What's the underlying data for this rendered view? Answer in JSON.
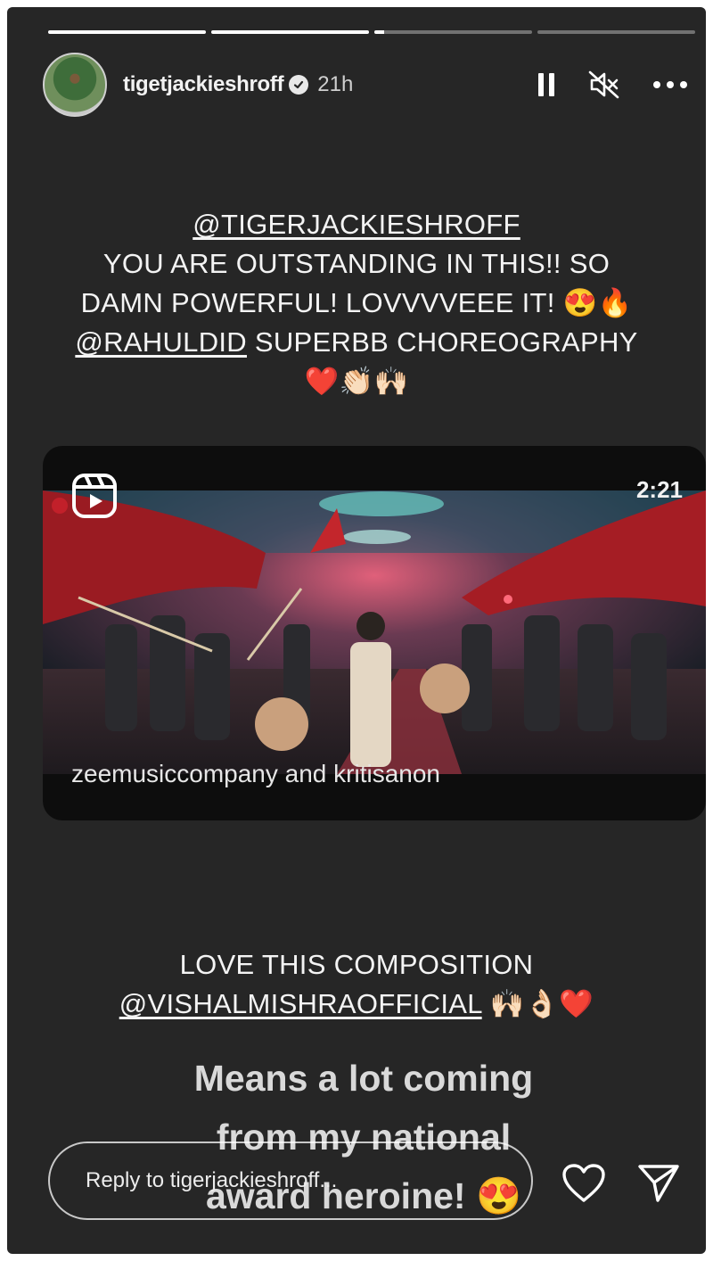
{
  "story": {
    "segment_progress": [
      1,
      1,
      0.06,
      0
    ]
  },
  "header": {
    "username": "tigetjackieshroff",
    "verified": true,
    "time_ago": "21h",
    "icons": [
      "pause-icon",
      "mute-icon",
      "more-icon"
    ]
  },
  "caption1": {
    "mention1": "@TIGERJACKIESHROFF",
    "line2": "YOU ARE OUTSTANDING IN THIS!! SO",
    "line3": "DAMN POWERFUL! LOVVVVEEE IT! 😍🔥",
    "mention2": "@RAHULDID",
    "line4_rest": " SUPERBB CHOREOGRAPHY",
    "line5": "❤️👏🏻🙌🏻"
  },
  "reel": {
    "duration": "2:21",
    "credit": "zeemusiccompany and kritisanon"
  },
  "caption2": {
    "line1": "LOVE THIS COMPOSITION",
    "mention": "@VISHALMISHRAOFFICIAL",
    "emojis": " 🙌🏻👌🏻❤️"
  },
  "sticker": {
    "line1": "Means a lot coming",
    "line2": "from my national",
    "line3": "award heroine! 😍"
  },
  "reply": {
    "placeholder": "Reply to tigerjackieshroff..."
  },
  "colors": {
    "background": "#262626",
    "text": "#f4f4f4",
    "heart_red": "#e0262b"
  }
}
